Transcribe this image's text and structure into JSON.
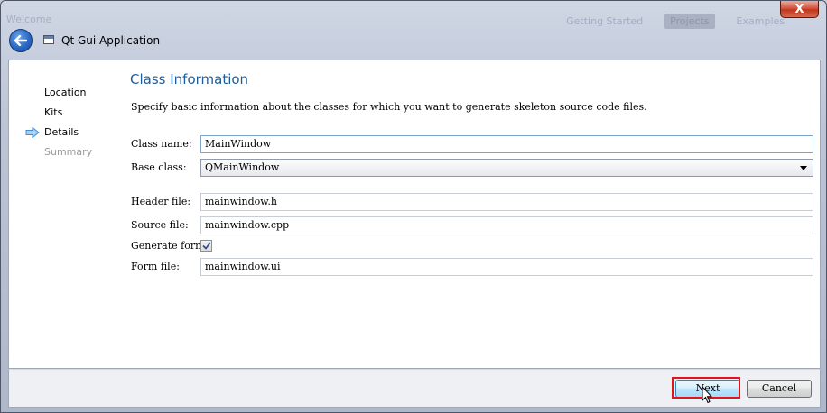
{
  "window": {
    "background_title": "Welcome",
    "background_tabs": [
      "Getting Started",
      "Projects",
      "Examples"
    ],
    "close_symbol": "X",
    "wizard_title": "Qt Gui Application"
  },
  "sidebar": {
    "items": [
      {
        "label": "Location",
        "state": "done"
      },
      {
        "label": "Kits",
        "state": "done"
      },
      {
        "label": "Details",
        "state": "current"
      },
      {
        "label": "Summary",
        "state": "pending"
      }
    ]
  },
  "page": {
    "title": "Class Information",
    "description": "Specify basic information about the classes for which you want to generate skeleton source code files."
  },
  "form": {
    "class_name": {
      "label": "Class name:",
      "value": "MainWindow"
    },
    "base_class": {
      "label": "Base class:",
      "value": "QMainWindow"
    },
    "header_file": {
      "label": "Header file:",
      "value": "mainwindow.h"
    },
    "source_file": {
      "label": "Source file:",
      "value": "mainwindow.cpp"
    },
    "generate_form": {
      "label": "Generate form:",
      "checked": true
    },
    "form_file": {
      "label": "Form file:",
      "value": "mainwindow.ui"
    }
  },
  "footer": {
    "next_label": "Next",
    "cancel_label": "Cancel"
  },
  "colors": {
    "heading": "#1e5c99",
    "highlight": "#e0141e",
    "nav_arrow": "#3b8fd9"
  },
  "icons": [
    "back-arrow-icon",
    "wizard-window-icon",
    "current-step-arrow-icon",
    "checkmark-icon",
    "dropdown-caret-icon",
    "mouse-cursor-icon"
  ]
}
